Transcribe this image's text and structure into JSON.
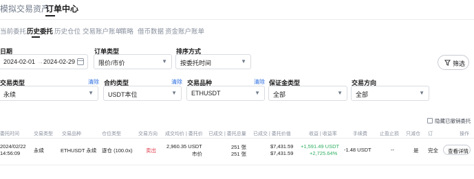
{
  "top_tabs": [
    "模拟交易资产",
    "订单中心"
  ],
  "sub_tabs": [
    "当前委托",
    "历史委托",
    "历史仓位",
    "交易账户账单",
    "策略",
    "借币数据",
    "资金账户账单"
  ],
  "filters": {
    "date": {
      "label": "日期",
      "start": "2024-02-01",
      "separator": "→",
      "end": "2024-02-29"
    },
    "order_type": {
      "label": "订单类型",
      "value": "限价/市价"
    },
    "sort": {
      "label": "排序方式",
      "value": "按委托时间"
    },
    "filter_button": "筛选",
    "trade_type": {
      "label": "交易类型",
      "clear": "清除",
      "value": "永续"
    },
    "contract_type": {
      "label": "合约类型",
      "clear": "清除",
      "value": "USDT本位"
    },
    "instrument": {
      "label": "交易品种",
      "clear": "清除",
      "value": "ETHUSDT"
    },
    "margin_type": {
      "label": "保证金类型",
      "value": "全部"
    },
    "direction": {
      "label": "交易方向",
      "value": "全部"
    }
  },
  "hide_cancelled": "隐藏已撤销委托",
  "table": {
    "headers": [
      "委托时间",
      "交易类型",
      "交易品种",
      "仓位类型",
      "交易方向",
      "成交均价 | 委托价",
      "已成交 | 委托总量",
      "已成交 | 委托价值",
      "收益 | 收益率",
      "手续费",
      "止盈止损",
      "只减仓",
      "订",
      "操作"
    ],
    "rows": [
      {
        "date": "2024/02/22",
        "time": "14:56:09",
        "trade_type": "永续",
        "instrument": "ETHUSDT 永续",
        "position_type": "逐仓 (100.0x)",
        "direction": "卖出",
        "avg_price": "2,960.35 USDT",
        "order_price": "市价",
        "filled_qty": "251 张",
        "total_qty": "251 张",
        "filled_value": "$7,431.59",
        "order_value": "$7,431.59",
        "pnl": "+1,591.49 USDT",
        "pnl_ratio": "+2,725.64%",
        "fee": "-1.48 USDT",
        "tp_sl": "--",
        "reduce_only": "是",
        "status": "完全",
        "action": "查看详情"
      }
    ]
  },
  "colors": {
    "accent": "#2b6de0",
    "sell": "#e0374a",
    "profit": "#2eae60"
  }
}
